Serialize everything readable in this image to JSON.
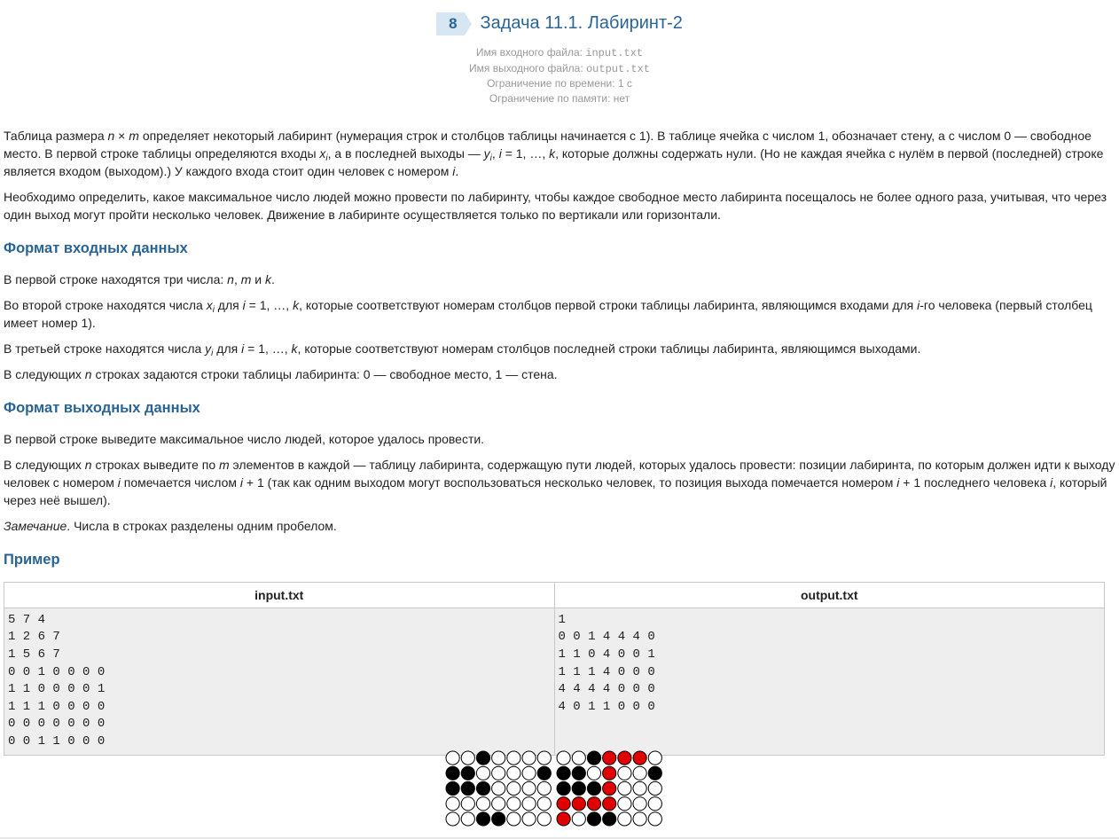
{
  "header": {
    "number": "8",
    "title": "Задача 11.1. Лабиринт-2",
    "input_file_label": "Имя входного файла: ",
    "input_file": "input.txt",
    "output_file_label": "Имя выходного файла: ",
    "output_file": "output.txt",
    "time_limit": "Ограничение по времени: 1 с",
    "memory_limit": "Ограничение по памяти: нет"
  },
  "statement": {
    "p1": {
      "a": "Таблица размера ",
      "n": "n",
      "times": " × ",
      "m": "m",
      "b": " определяет некоторый лабиринт (нумерация строк и столбцов таблицы начинается с 1). В таблице ячейка с числом 1, обозначает стену, а с числом 0 — свободное место. В первой строке таблицы определяются входы ",
      "x": "x",
      "xi": "i",
      "c": ", а в последней выходы — ",
      "y": "y",
      "yi": "i",
      "d": ", ",
      "i": "i",
      "e": " = 1, …, ",
      "k": "k",
      "f": ", которые должны содержать нули. (Но не каждая ячейка с нулём в первой (последней) строке является входом (выходом).) У каждого входа стоит один человек с номером ",
      "i2": "i",
      "g": "."
    },
    "p2": "Необходимо определить, какое максимальное число людей можно провести по лабиринту, чтобы каждое свободное место лабиринта посещалось не более одного раза, учитывая, что через один выход могут пройти несколько человек. Движение в лабиринте осуществляется только по вертикали или горизонтали."
  },
  "input_format": {
    "heading": "Формат входных данных",
    "p1": {
      "a": "В первой строке находятся три числа: ",
      "n": "n",
      "sep1": ", ",
      "m": "m",
      "sep2": " и ",
      "k": "k",
      "end": "."
    },
    "p2": {
      "a": "Во второй строке находятся числа ",
      "x": "x",
      "xi": "i",
      "b": " для ",
      "i": "i",
      "c": " = 1, …, ",
      "k": "k",
      "d": ", которые соответствуют номерам столбцов первой строки таблицы лабиринта, являющимся входами для ",
      "i2": "i",
      "e": "-го человека (первый столбец имеет номер 1)."
    },
    "p3": {
      "a": "В третьей строке находятся числа ",
      "y": "y",
      "yi": "i",
      "b": " для ",
      "i": "i",
      "c": " = 1, …, ",
      "k": "k",
      "d": ", которые соответствуют номерам столбцов последней строки таблицы лабиринта, являющимся выходами."
    },
    "p4": {
      "a": "В следующих ",
      "n": "n",
      "b": " строках задаются строки таблицы лабиринта: 0 — свободное место, 1 — стена."
    }
  },
  "output_format": {
    "heading": "Формат выходных данных",
    "p1": "В первой строке выведите максимальное число людей, которое удалось провести.",
    "p2": {
      "a": "В следующих ",
      "n": "n",
      "b": " строках выведите по ",
      "m": "m",
      "c": " элементов в каждой — таблицу лабиринта, содержащую пути людей, которых удалось провести: позиции лабиринта, по которым должен идти к выходу человек с номером ",
      "i": "i",
      "d": " помечается числом ",
      "i2": "i",
      "e": " + 1 (так как одним выходом могут воспользоваться несколько человек, то позиция выхода помечается номером ",
      "i3": "i",
      "f": " + 1 последнего человека ",
      "i4": "i",
      "g": ", который через неё вышел)."
    },
    "note_label": "Замечание",
    "note_text": ". Числа в строках разделены одним пробелом."
  },
  "example": {
    "heading": "Пример",
    "col_input": "input.txt",
    "col_output": "output.txt",
    "input": "5 7 4\n1 2 6 7\n1 5 6 7\n0 0 1 0 0 0 0\n1 1 0 0 0 0 1\n1 1 1 0 0 0 0\n0 0 0 0 0 0 0\n0 0 1 1 0 0 0",
    "output": "1\n0 0 1 4 4 4 0\n1 1 0 4 0 0 1\n1 1 1 4 0 0 0\n4 4 4 4 0 0 0\n4 0 1 1 0 0 0"
  },
  "illustration": {
    "colors": {
      "wall": "#000000",
      "path": "#e00000",
      "free": "#ffffff",
      "border": "#000000"
    },
    "left_grid": [
      [
        0,
        0,
        1,
        0,
        0,
        0,
        0
      ],
      [
        1,
        1,
        0,
        0,
        0,
        0,
        1
      ],
      [
        1,
        1,
        1,
        0,
        0,
        0,
        0
      ],
      [
        0,
        0,
        0,
        0,
        0,
        0,
        0
      ],
      [
        0,
        0,
        1,
        1,
        0,
        0,
        0
      ]
    ],
    "right_grid": [
      [
        0,
        0,
        1,
        2,
        2,
        2,
        0
      ],
      [
        1,
        1,
        0,
        2,
        0,
        0,
        1
      ],
      [
        1,
        1,
        1,
        2,
        0,
        0,
        0
      ],
      [
        2,
        2,
        2,
        2,
        0,
        0,
        0
      ],
      [
        2,
        0,
        1,
        1,
        0,
        0,
        0
      ]
    ]
  }
}
